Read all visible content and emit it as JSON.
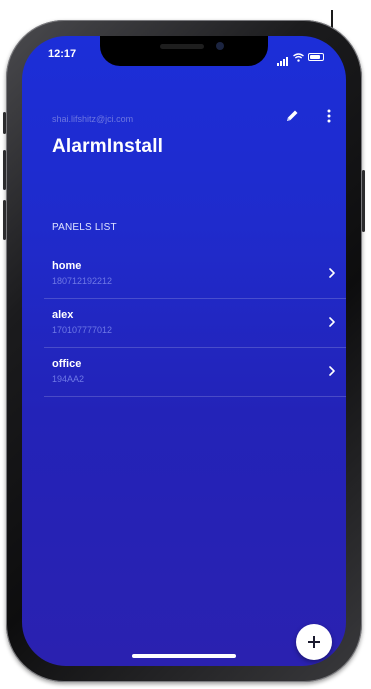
{
  "status_bar": {
    "time": "12:17"
  },
  "header": {
    "email": "shai.lifshitz@jci.com",
    "title": "AlarmInstall",
    "edit_icon": "pencil-icon",
    "more_icon": "more-vertical-icon"
  },
  "panels": {
    "section_title": "PANELS LIST",
    "items": [
      {
        "name": "home",
        "id": "180712192212"
      },
      {
        "name": "alex",
        "id": "170107777012"
      },
      {
        "name": "office",
        "id": "194AA2"
      }
    ]
  },
  "fab": {
    "icon": "plus-icon"
  },
  "colors": {
    "screen_background": "#1f2bcc",
    "secondary_text": "#6f79e6"
  }
}
